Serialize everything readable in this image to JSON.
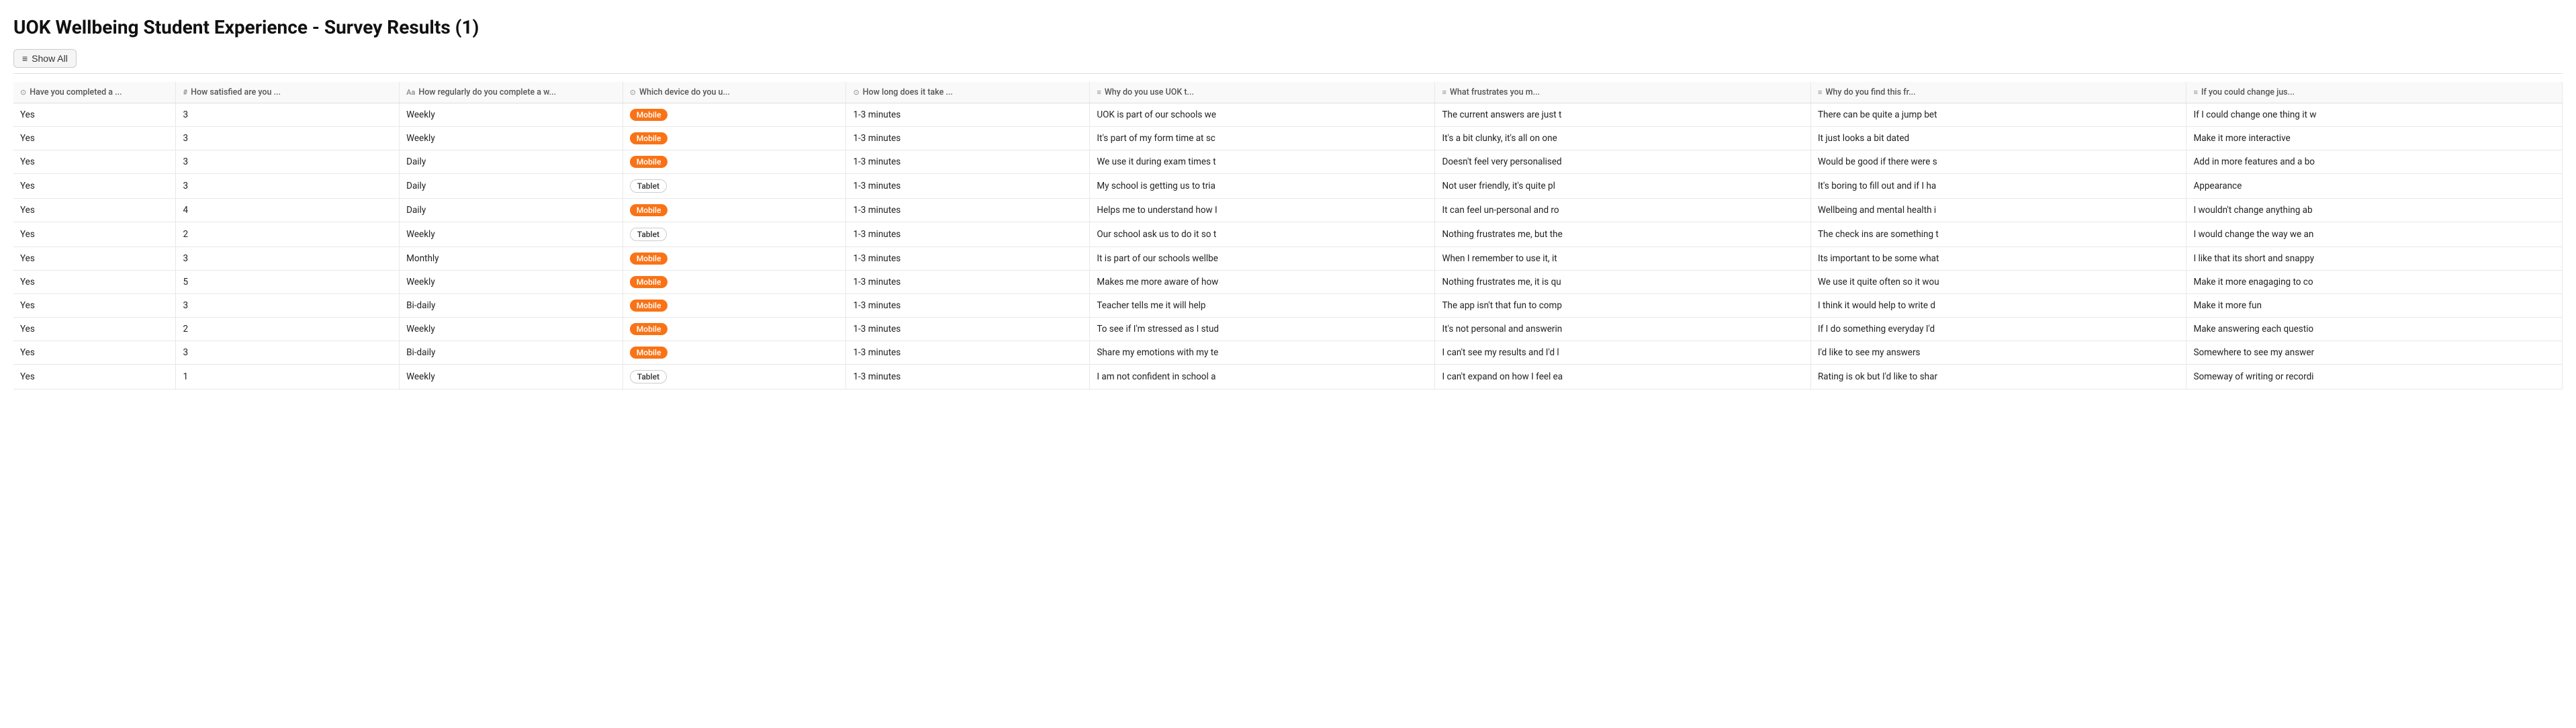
{
  "page": {
    "title": "UOK Wellbeing Student Experience - Survey Results (1)"
  },
  "toolbar": {
    "show_all_label": "Show All",
    "show_all_icon": "≡"
  },
  "columns": [
    {
      "id": "completed",
      "icon": "⊙",
      "label": "Have you completed a ...",
      "type": "icon-circle"
    },
    {
      "id": "satisfied",
      "icon": "#",
      "label": "How satisfied are you ...",
      "type": "hash"
    },
    {
      "id": "regularly",
      "icon": "Aa",
      "label": "How regularly do you complete a w...",
      "type": "text"
    },
    {
      "id": "device",
      "icon": "⊙",
      "label": "Which device do you u...",
      "type": "icon-circle"
    },
    {
      "id": "howlong",
      "icon": "⊙",
      "label": "How long does it take ...",
      "type": "icon-circle"
    },
    {
      "id": "why",
      "icon": "≡",
      "label": "Why do you use UOK t...",
      "type": "lines"
    },
    {
      "id": "frustrate",
      "icon": "≡",
      "label": "What frustrates you m...",
      "type": "lines"
    },
    {
      "id": "find",
      "icon": "≡",
      "label": "Why do you find this fr...",
      "type": "lines"
    },
    {
      "id": "change",
      "icon": "≡",
      "label": "If you could change jus...",
      "type": "lines"
    }
  ],
  "rows": [
    {
      "completed": "Yes",
      "satisfied": "3",
      "regularly": "Weekly",
      "device": "Mobile",
      "howlong": "1-3 minutes",
      "why": "UOK is part of our schools we",
      "frustrate": "The current answers are just t",
      "find": "There can be quite a jump bet",
      "change": "If I could change one thing it w"
    },
    {
      "completed": "Yes",
      "satisfied": "3",
      "regularly": "Weekly",
      "device": "Mobile",
      "howlong": "1-3 minutes",
      "why": "It's part of my form time at sc",
      "frustrate": "It's a bit clunky, it's all on one",
      "find": "It just looks a bit dated",
      "change": "Make it more interactive"
    },
    {
      "completed": "Yes",
      "satisfied": "3",
      "regularly": "Daily",
      "device": "Mobile",
      "howlong": "1-3 minutes",
      "why": "We use it during exam times t",
      "frustrate": "Doesn't feel very personalised",
      "find": "Would be good if there were s",
      "change": "Add in more features and a bo"
    },
    {
      "completed": "Yes",
      "satisfied": "3",
      "regularly": "Daily",
      "device": "Tablet",
      "howlong": "1-3 minutes",
      "why": "My school is getting us to tria",
      "frustrate": "Not user friendly, it's quite pl",
      "find": "It's boring to fill out and if I ha",
      "change": "Appearance"
    },
    {
      "completed": "Yes",
      "satisfied": "4",
      "regularly": "Daily",
      "device": "Mobile",
      "howlong": "1-3 minutes",
      "why": "Helps me to understand how I",
      "frustrate": "It can feel un-personal and ro",
      "find": "Wellbeing and mental health i",
      "change": "I wouldn't change anything ab"
    },
    {
      "completed": "Yes",
      "satisfied": "2",
      "regularly": "Weekly",
      "device": "Tablet",
      "howlong": "1-3 minutes",
      "why": "Our school ask us to do it so t",
      "frustrate": "Nothing frustrates me, but the",
      "find": "The check ins are something t",
      "change": "I would change the way we an"
    },
    {
      "completed": "Yes",
      "satisfied": "3",
      "regularly": "Monthly",
      "device": "Mobile",
      "howlong": "1-3 minutes",
      "why": "It is part of our schools wellbe",
      "frustrate": "When I remember to use it, it",
      "find": "Its important to be some what",
      "change": "I like that its short and snappy"
    },
    {
      "completed": "Yes",
      "satisfied": "5",
      "regularly": "Weekly",
      "device": "Mobile",
      "howlong": "1-3 minutes",
      "why": "Makes me more aware of how",
      "frustrate": "Nothing frustrates me, it is qu",
      "find": "We use it quite often so it wou",
      "change": "Make it more enagaging to co"
    },
    {
      "completed": "Yes",
      "satisfied": "3",
      "regularly": "Bi-daily",
      "device": "Mobile",
      "howlong": "1-3 minutes",
      "why": "Teacher tells me it will help",
      "frustrate": "The app isn't that fun to comp",
      "find": "I think it would help to write d",
      "change": "Make it more fun"
    },
    {
      "completed": "Yes",
      "satisfied": "2",
      "regularly": "Weekly",
      "device": "Mobile",
      "howlong": "1-3 minutes",
      "why": "To see if I'm stressed as I stud",
      "frustrate": "It's not personal and answerin",
      "find": "If I do something everyday I'd",
      "change": "Make answering each questio"
    },
    {
      "completed": "Yes",
      "satisfied": "3",
      "regularly": "Bi-daily",
      "device": "Mobile",
      "howlong": "1-3 minutes",
      "why": "Share my emotions with my te",
      "frustrate": "I can't see my results and I'd l",
      "find": "I'd like to see my answers",
      "change": "Somewhere to see my answer"
    },
    {
      "completed": "Yes",
      "satisfied": "1",
      "regularly": "Weekly",
      "device": "Tablet",
      "howlong": "1-3 minutes",
      "why": "I am not confident in school a",
      "frustrate": "I can't expand on how I feel ea",
      "find": "Rating is ok but I'd like to shar",
      "change": "Someway of writing or recordi"
    }
  ]
}
